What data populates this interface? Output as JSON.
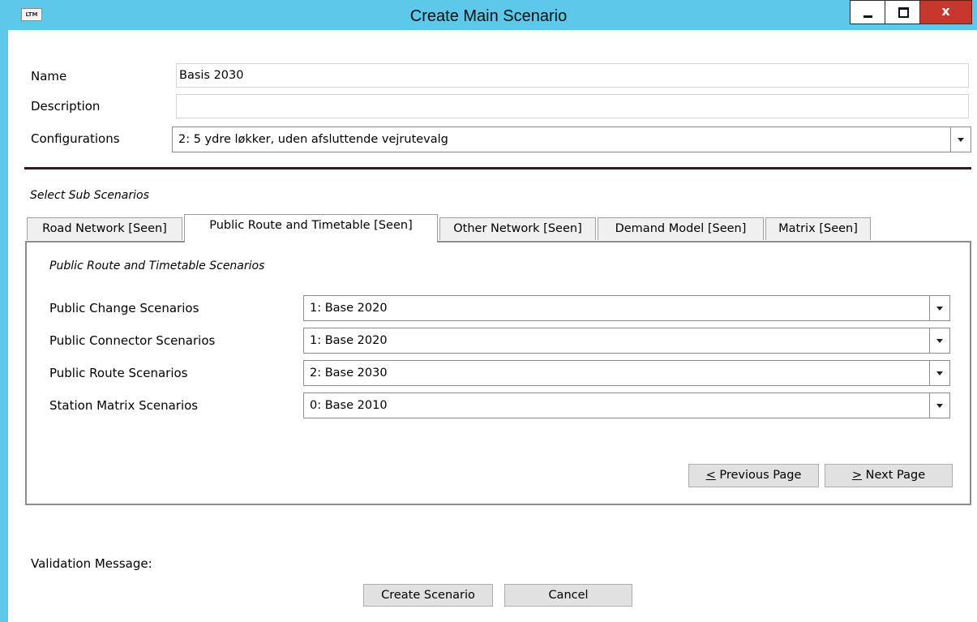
{
  "window": {
    "title": "Create Main Scenario",
    "app_icon_text": "LTM",
    "close_symbol": "x",
    "accent_color": "#5ec8ea"
  },
  "form": {
    "name_label": "Name",
    "name_value": "Basis 2030",
    "description_label": "Description",
    "description_value": "",
    "configurations_label": "Configurations",
    "configurations_value": "2: 5 ydre løkker, uden afsluttende vejrutevalg"
  },
  "sub_scenarios": {
    "heading": "Select Sub Scenarios",
    "tabs": [
      {
        "label": "Road Network [Seen]"
      },
      {
        "label": "Public Route and Timetable [Seen]"
      },
      {
        "label": "Other Network [Seen]"
      },
      {
        "label": "Demand Model [Seen]"
      },
      {
        "label": "Matrix [Seen]"
      }
    ],
    "active_tab": 1,
    "panel": {
      "heading": "Public Route and Timetable Scenarios",
      "rows": [
        {
          "label": "Public Change Scenarios",
          "value": "1: Base 2020"
        },
        {
          "label": "Public Connector Scenarios",
          "value": "1: Base 2020"
        },
        {
          "label": "Public Route Scenarios",
          "value": "2: Base 2030"
        },
        {
          "label": "Station Matrix Scenarios",
          "value": "0: Base 2010"
        }
      ],
      "prev_mnemonic": "<",
      "prev_rest": " Previous Page",
      "next_mnemonic": ">",
      "next_rest": " Next Page"
    }
  },
  "footer": {
    "validation_label": "Validation Message:",
    "create_label": "Create Scenario",
    "cancel_label": "Cancel"
  }
}
